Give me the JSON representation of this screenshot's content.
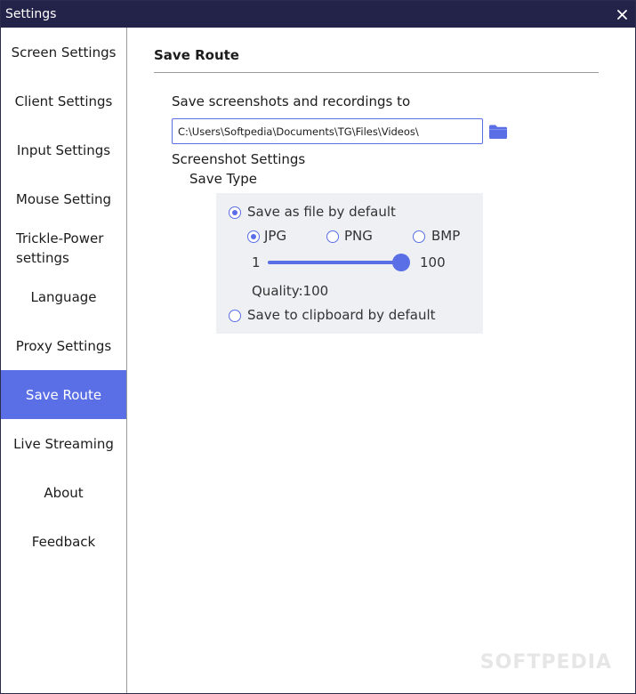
{
  "window": {
    "title": "Settings"
  },
  "sidebar": {
    "items": [
      {
        "label": "Screen Settings"
      },
      {
        "label": "Client Settings"
      },
      {
        "label": "Input Settings"
      },
      {
        "label": "Mouse Setting"
      },
      {
        "label": "Trickle-Power settings"
      },
      {
        "label": "Language"
      },
      {
        "label": "Proxy Settings"
      },
      {
        "label": "Save Route",
        "active": true
      },
      {
        "label": "Live Streaming"
      },
      {
        "label": "About"
      },
      {
        "label": "Feedback"
      }
    ]
  },
  "content": {
    "section_title": "Save Route",
    "save_to_label": "Save screenshots and recordings to",
    "save_path": "C:\\Users\\Softpedia\\Documents\\TG\\Files\\Videos\\",
    "screenshot_settings_label": "Screenshot Settings",
    "save_type_label": "Save Type",
    "save_as_file": {
      "label": "Save as file by default",
      "checked": true
    },
    "formats": [
      {
        "label": "JPG",
        "checked": true
      },
      {
        "label": "PNG",
        "checked": false
      },
      {
        "label": "BMP",
        "checked": false
      }
    ],
    "quality": {
      "min_label": "1",
      "max_label": "100",
      "min": 1,
      "max": 100,
      "value": 100,
      "text": "Quality:100"
    },
    "save_to_clipboard": {
      "label": "Save to clipboard by default",
      "checked": false
    }
  },
  "watermark": "SOFTPEDIA",
  "colors": {
    "titlebar": "#23234a",
    "accent": "#5a6ee6",
    "panel_bg": "#eef0f4"
  }
}
